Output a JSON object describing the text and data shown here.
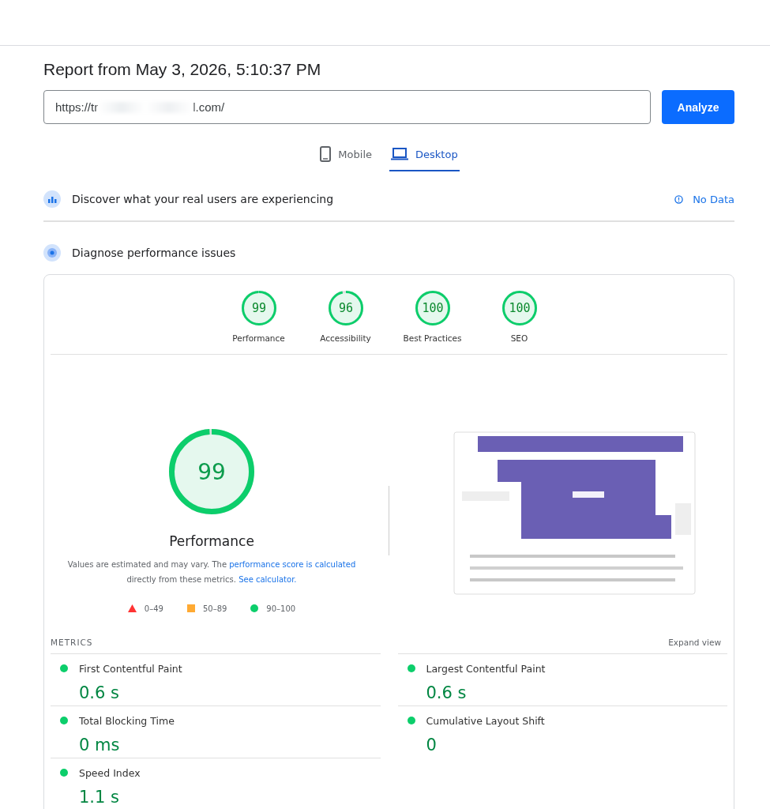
{
  "report_title": "Report from May 3, 2026, 5:10:37 PM",
  "url_field": {
    "value_start": "https://tr",
    "value_end": "l.com/"
  },
  "analyze_button": "Analyze",
  "device_tabs": [
    {
      "label": "Mobile",
      "kind": "phone",
      "selected": false
    },
    {
      "label": "Desktop",
      "kind": "laptop",
      "selected": true
    }
  ],
  "field_data": {
    "title": "Discover what your real users are experiencing",
    "status": "No Data"
  },
  "lab_data": {
    "title": "Diagnose performance issues"
  },
  "category_gauges": [
    {
      "score": "99",
      "label": "Performance",
      "level": 0.99
    },
    {
      "score": "96",
      "label": "Accessibility",
      "level": 0.96
    },
    {
      "score": "100",
      "label": "Best Practices",
      "level": 1
    },
    {
      "score": "100",
      "label": "SEO",
      "level": 1
    }
  ],
  "main_gauge": {
    "score": "99",
    "label": "Performance",
    "level": 0.99
  },
  "note": {
    "text": "Values are estimated and may vary. The ",
    "link1": "performance score is calculated",
    "middle": " directly from these metrics.",
    "link2": "See calculator."
  },
  "legend": [
    {
      "kind": "triangle",
      "range": "0–49",
      "color": "#ff3333"
    },
    {
      "kind": "square",
      "range": "50–89",
      "color": "#ffaa33"
    },
    {
      "kind": "circle",
      "range": "90–100",
      "color": "#0cce6b"
    }
  ],
  "metrics_header": "METRICS",
  "expand_view": "Expand view",
  "metrics": [
    {
      "label": "First Contentful Paint",
      "value": "0.6 s",
      "color": "#0cce6b"
    },
    {
      "label": "Largest Contentful Paint",
      "value": "0.6 s",
      "color": "#0cce6b"
    },
    {
      "label": "Total Blocking Time",
      "value": "0 ms",
      "color": "#0cce6b"
    },
    {
      "label": "Cumulative Layout Shift",
      "value": "0",
      "color": "#0cce6b"
    },
    {
      "label": "Speed Index",
      "value": "1.1 s",
      "color": "#0cce6b"
    }
  ]
}
